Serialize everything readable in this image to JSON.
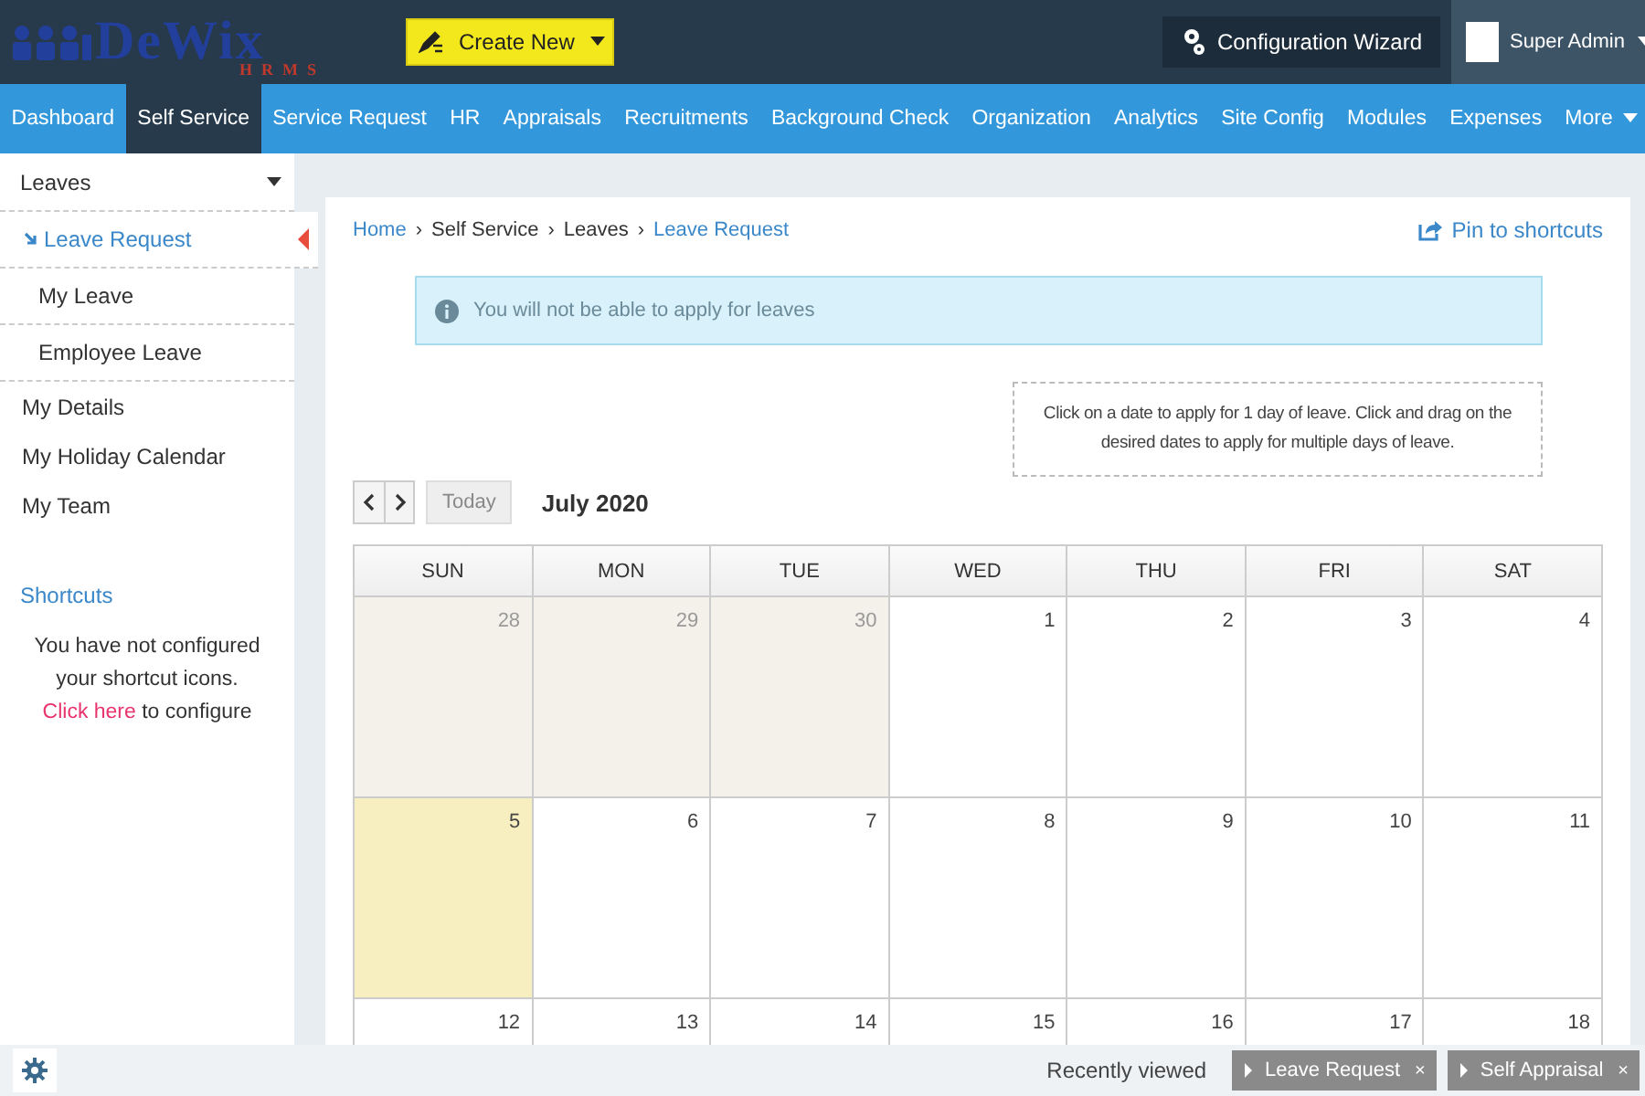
{
  "header": {
    "logo": {
      "name": "DeWix",
      "tag": "HRMS"
    },
    "create_button": "Create New",
    "config_button": "Configuration Wizard",
    "user": "Super Admin"
  },
  "nav": [
    {
      "label": "Dashboard",
      "selected": false
    },
    {
      "label": "Self Service",
      "selected": true
    },
    {
      "label": "Service Request",
      "selected": false
    },
    {
      "label": "HR",
      "selected": false
    },
    {
      "label": "Appraisals",
      "selected": false
    },
    {
      "label": "Recruitments",
      "selected": false
    },
    {
      "label": "Background Check",
      "selected": false
    },
    {
      "label": "Organization",
      "selected": false
    },
    {
      "label": "Analytics",
      "selected": false
    },
    {
      "label": "Site Config",
      "selected": false
    },
    {
      "label": "Modules",
      "selected": false
    },
    {
      "label": "Expenses",
      "selected": false
    },
    {
      "label": "More",
      "selected": false,
      "dropdown": true
    }
  ],
  "sidebar": {
    "group": {
      "title": "Leaves",
      "expanded": true,
      "children": [
        {
          "label": "Leave Request",
          "selected": true
        },
        {
          "label": "My Leave",
          "selected": false
        },
        {
          "label": "Employee Leave",
          "selected": false
        }
      ]
    },
    "links": [
      {
        "label": "My Details",
        "selected": false
      },
      {
        "label": "My Holiday Calendar",
        "selected": false
      },
      {
        "label": "My Team",
        "selected": false
      }
    ],
    "shortcuts": {
      "title": "Shortcuts",
      "message": "You have not configured your shortcut icons.",
      "link": "Click here",
      "suffix": "to configure"
    }
  },
  "breadcrumb": [
    {
      "label": "Home",
      "kind": "link"
    },
    {
      "label": "Self Service",
      "kind": "text"
    },
    {
      "label": "Leaves",
      "kind": "text"
    },
    {
      "label": "Leave Request",
      "kind": "link"
    }
  ],
  "breadcrumb_separator": "›",
  "pin": "Pin to shortcuts",
  "alert": "You will not be able to apply for leaves",
  "hint": "Click on a date to apply for 1 day of leave. Click and drag on the desired dates to apply for multiple days of leave.",
  "calendar": {
    "today_button": "Today",
    "today_disabled": true,
    "month": "July 2020",
    "weekdays": [
      "SUN",
      "MON",
      "TUE",
      "WED",
      "THU",
      "FRI",
      "SAT"
    ],
    "weeks": [
      [
        {
          "day": "28",
          "other_month": true,
          "today": false
        },
        {
          "day": "29",
          "other_month": true,
          "today": false
        },
        {
          "day": "30",
          "other_month": true,
          "today": false
        },
        {
          "day": "1",
          "other_month": false,
          "today": false
        },
        {
          "day": "2",
          "other_month": false,
          "today": false
        },
        {
          "day": "3",
          "other_month": false,
          "today": false
        },
        {
          "day": "4",
          "other_month": false,
          "today": false
        }
      ],
      [
        {
          "day": "5",
          "other_month": false,
          "today": true
        },
        {
          "day": "6",
          "other_month": false,
          "today": false
        },
        {
          "day": "7",
          "other_month": false,
          "today": false
        },
        {
          "day": "8",
          "other_month": false,
          "today": false
        },
        {
          "day": "9",
          "other_month": false,
          "today": false
        },
        {
          "day": "10",
          "other_month": false,
          "today": false
        },
        {
          "day": "11",
          "other_month": false,
          "today": false
        }
      ],
      [
        {
          "day": "12",
          "other_month": false,
          "today": false
        },
        {
          "day": "13",
          "other_month": false,
          "today": false
        },
        {
          "day": "14",
          "other_month": false,
          "today": false
        },
        {
          "day": "15",
          "other_month": false,
          "today": false
        },
        {
          "day": "16",
          "other_month": false,
          "today": false
        },
        {
          "day": "17",
          "other_month": false,
          "today": false
        },
        {
          "day": "18",
          "other_month": false,
          "today": false
        }
      ]
    ]
  },
  "footer": {
    "label": "Recently viewed",
    "recent": [
      {
        "label": "Leave Request",
        "close": "×"
      },
      {
        "label": "Self Appraisal",
        "close": "×"
      }
    ]
  }
}
